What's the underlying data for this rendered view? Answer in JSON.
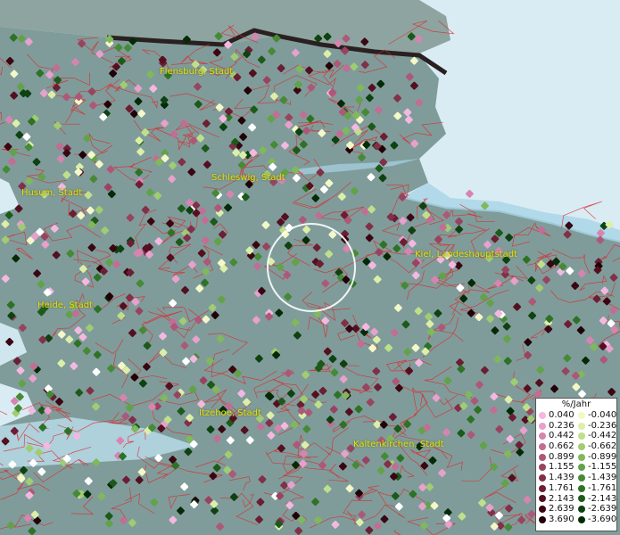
{
  "cities": [
    {
      "id": "flensburg",
      "label": "Flensburg, Stadt"
    },
    {
      "id": "husum",
      "label": "Husum, Stadt"
    },
    {
      "id": "schleswig",
      "label": "Schleswig, Stadt"
    },
    {
      "id": "kiel",
      "label": "Kiel, Landeshauptstadt"
    },
    {
      "id": "heide",
      "label": "Heide, Stadt"
    },
    {
      "id": "itzehoe",
      "label": "Itzehoe, Stadt"
    },
    {
      "id": "kaltenkirchen",
      "label": "Kaltenkirchen, Stadt"
    }
  ],
  "legend": {
    "title": "%/Jahr",
    "positive": [
      {
        "value": "0.040",
        "color": "#f4b8e0"
      },
      {
        "value": "0.236",
        "color": "#e8a0cc"
      },
      {
        "value": "0.442",
        "color": "#d884b0"
      },
      {
        "value": "0.662",
        "color": "#c26e94"
      },
      {
        "value": "0.899",
        "color": "#ad5878"
      },
      {
        "value": "1.155",
        "color": "#984460"
      },
      {
        "value": "1.439",
        "color": "#823048"
      },
      {
        "value": "1.761",
        "color": "#6c1e34"
      },
      {
        "value": "2.143",
        "color": "#541020"
      },
      {
        "value": "2.639",
        "color": "#3a0612"
      },
      {
        "value": "3.690",
        "color": "#220008"
      }
    ],
    "negative": [
      {
        "value": "-0.040",
        "color": "#f4f8c8"
      },
      {
        "value": "-0.236",
        "color": "#dcefa8"
      },
      {
        "value": "-0.442",
        "color": "#bfe08a"
      },
      {
        "value": "-0.662",
        "color": "#a0cc72"
      },
      {
        "value": "-0.899",
        "color": "#80b85c"
      },
      {
        "value": "-1.155",
        "color": "#62a248"
      },
      {
        "value": "-1.439",
        "color": "#468a36"
      },
      {
        "value": "-1.761",
        "color": "#2e7226"
      },
      {
        "value": "-2.143",
        "color": "#1c5a1a"
      },
      {
        "value": "-2.639",
        "color": "#0e4210"
      },
      {
        "value": "-3.690",
        "color": "#042a06"
      }
    ]
  },
  "colors": {
    "land": "#7f9c9a",
    "sea": "#d9ecf4",
    "coast_shallow": "#a8d4e6",
    "boundary": "#e0262a",
    "border_line": "#2a2020",
    "city_label": "#e8e000",
    "selection_ring": "#ffffff"
  }
}
